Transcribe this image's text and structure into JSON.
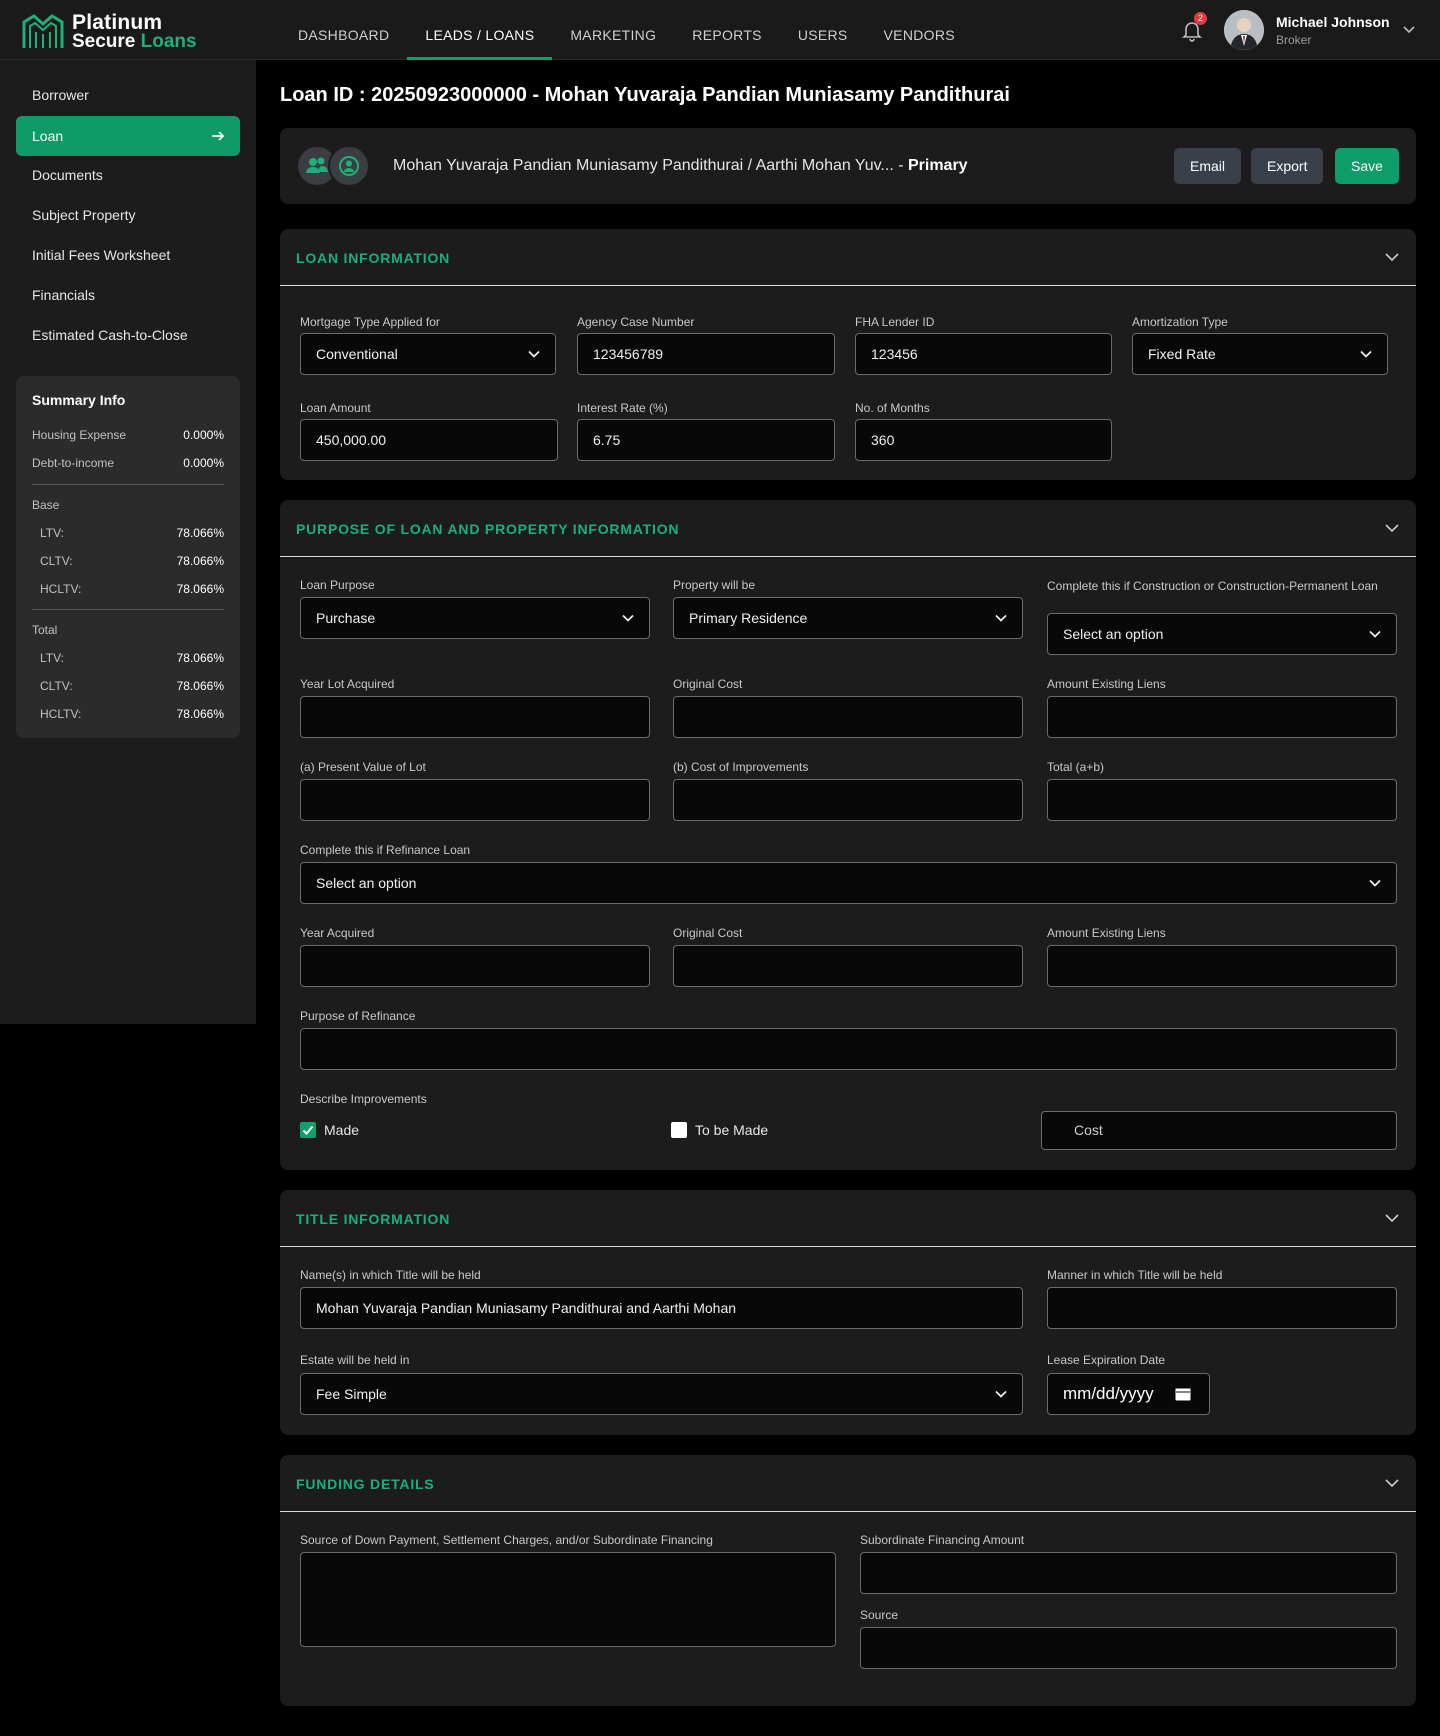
{
  "app": {
    "brand_line1": "Platinum",
    "brand_line2a": "Secure",
    "brand_line2b": "Loans",
    "accent": "#10a06b"
  },
  "nav": {
    "items": [
      "DASHBOARD",
      "LEADS / LOANS",
      "MARKETING",
      "REPORTS",
      "USERS",
      "VENDORS"
    ],
    "active": "LEADS / LOANS"
  },
  "user": {
    "name": "Michael Johnson",
    "role": "Broker",
    "notifications": "2"
  },
  "sidebar": {
    "items": [
      "Borrower",
      "Loan",
      "Documents",
      "Subject Property",
      "Initial Fees Worksheet",
      "Financials",
      "Estimated Cash-to-Close"
    ],
    "active": "Loan"
  },
  "summary": {
    "title": "Summary Info",
    "housing_label": "Housing Expense",
    "housing_value": "0.000%",
    "dti_label": "Debt-to-income",
    "dti_value": "0.000%",
    "base_label": "Base",
    "base_ltv_label": "LTV:",
    "base_ltv": "78.066%",
    "base_cltv_label": "CLTV:",
    "base_cltv": "78.066%",
    "base_hcltv_label": "HCLTV:",
    "base_hcltv": "78.066%",
    "total_label": "Total",
    "total_ltv_label": "LTV:",
    "total_ltv": "78.066%",
    "total_cltv_label": "CLTV:",
    "total_cltv": "78.066%",
    "total_hcltv_label": "HCLTV:",
    "total_hcltv": "78.066%"
  },
  "page": {
    "title": "Loan ID : 20250923000000 - Mohan Yuvaraja Pandian Muniasamy Pandithurai"
  },
  "borrower": {
    "names": "Mohan Yuvaraja Pandian Muniasamy Pandithurai / Aarthi Mohan Yuv... -",
    "tag": "Primary",
    "email_btn": "Email",
    "export_btn": "Export",
    "save_btn": "Save"
  },
  "loan_info": {
    "title": "LOAN INFORMATION",
    "mortgage_type_label": "Mortgage Type Applied for",
    "mortgage_type": "Conventional",
    "agency_case_label": "Agency Case Number",
    "agency_case": "123456789",
    "fha_lender_label": "FHA Lender ID",
    "fha_lender": "123456",
    "amort_label": "Amortization Type",
    "amort": "Fixed Rate",
    "loan_amount_label": "Loan Amount",
    "loan_amount": "450,000.00",
    "rate_label": "Interest Rate (%)",
    "rate": "6.75",
    "months_label": "No. of Months",
    "months": "360"
  },
  "purpose": {
    "title": "PURPOSE OF LOAN AND PROPERTY INFORMATION",
    "loan_purpose_label": "Loan Purpose",
    "loan_purpose": "Purchase",
    "property_label": "Property will be",
    "property": "Primary Residence",
    "construction_label": "Complete this if Construction or Construction-Permanent Loan",
    "construction": "Select an option",
    "year_lot_label": "Year Lot Acquired",
    "orig_cost_label": "Original Cost",
    "liens_label": "Amount Existing Liens",
    "present_value_label": "(a) Present Value of Lot",
    "improvements_cost_label": "(b) Cost of Improvements",
    "total_label": "Total (a+b)",
    "refinance_label": "Complete this if Refinance Loan",
    "refinance": "Select an option",
    "year_acq_label": "Year Acquired",
    "orig_cost2_label": "Original Cost",
    "liens2_label": "Amount Existing Liens",
    "refi_purpose_label": "Purpose of Refinance",
    "describe_label": "Describe Improvements",
    "made_label": "Made",
    "to_be_made_label": "To be Made",
    "cost_placeholder": "Cost"
  },
  "title_info": {
    "title": "TITLE INFORMATION",
    "names_label": "Name(s) in which Title will be held",
    "names": "Mohan Yuvaraja Pandian Muniasamy Pandithurai and Aarthi Mohan",
    "manner_label": "Manner in which Title will be held",
    "estate_label": "Estate will be held in",
    "estate": "Fee Simple",
    "lease_label": "Lease Expiration Date",
    "lease_placeholder": "mm/dd/yyyy"
  },
  "funding": {
    "title": "FUNDING DETAILS",
    "source_label": "Source of Down Payment, Settlement Charges, and/or Subordinate Financing",
    "sub_amount_label": "Subordinate Financing Amount",
    "source2_label": "Source"
  }
}
